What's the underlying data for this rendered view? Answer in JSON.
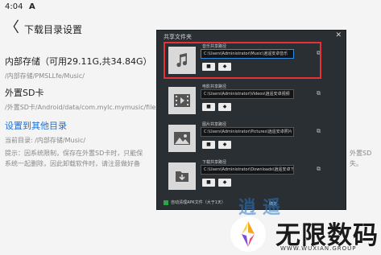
{
  "status_bar": {
    "time": "4:04",
    "notification": "A"
  },
  "header": {
    "back_glyph": "〈",
    "title": "下载目录设置"
  },
  "internal_storage": {
    "label": "内部存储（可用29.11G,共34.84G）",
    "path": "/内部存储/PMSLLfe/Music/"
  },
  "sd_card": {
    "label": "外置SD卡",
    "path": "/外置SD卡/Android/data/com.mylc.mymusic/files/"
  },
  "other_dir": {
    "label": "设置到其他目录",
    "path": "当前目录: /内部存储/Music/"
  },
  "note": {
    "line1": "提示：因系统限制，保存在外置SD卡时，只能保",
    "line1_tail": "外置SD",
    "line2": "系统一起删除，因此卸载软件时，请注意做好备",
    "line2_tail": "失。"
  },
  "dialog": {
    "title": "共享文件夹",
    "close": "✕",
    "items": [
      {
        "label": "音乐共享路径",
        "path": "C:\\Users\\Administrator\\Music\\逍遥安卓音乐",
        "icon": "music-icon"
      },
      {
        "label": "电影共享路径",
        "path": "C:\\Users\\Administrator\\Videos\\逍遥安卓视频",
        "icon": "video-icon"
      },
      {
        "label": "图片共享路径",
        "path": "C:\\Users\\Administrator\\Pictures\\逍遥安卓照片",
        "icon": "picture-icon"
      },
      {
        "label": "下载共享路径",
        "path": "C:\\Users\\Administrator\\Downloads\\逍遥安卓下载",
        "icon": "download-icon"
      }
    ],
    "open_glyph": "⧉",
    "footer_checkbox": "自动清理APK文件（大于1天）",
    "ok_label": "确定"
  },
  "watermark": {
    "main": "无限数码",
    "sub": "WWW.WUXIAN.GROUP",
    "ghost": "逍遥"
  },
  "colors": {
    "highlight": "#e53238",
    "link": "#1f6fd1",
    "dialog_bg": "#2a2f33",
    "input_focus": "#2d8de1"
  }
}
